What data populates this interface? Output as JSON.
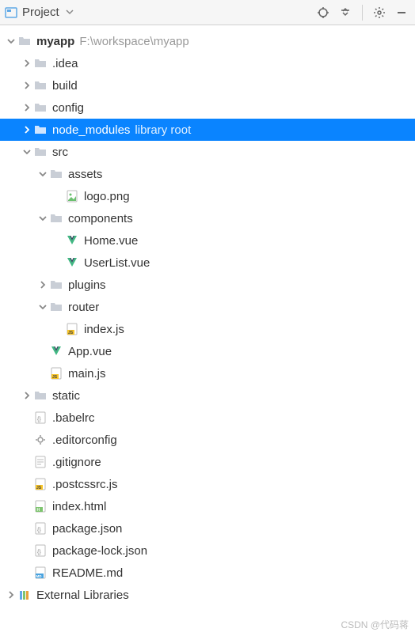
{
  "toolbar": {
    "project_label": "Project"
  },
  "tree": {
    "root": {
      "name": "myapp",
      "path": "F:\\workspace\\myapp"
    },
    "idea": ".idea",
    "build": "build",
    "config": "config",
    "node_modules": {
      "name": "node_modules",
      "hint": "library root"
    },
    "src": "src",
    "assets": "assets",
    "logo": "logo.png",
    "components": "components",
    "home": "Home.vue",
    "userlist": "UserList.vue",
    "plugins": "plugins",
    "router": "router",
    "index_js": "index.js",
    "app_vue": "App.vue",
    "main_js": "main.js",
    "static": "static",
    "babelrc": ".babelrc",
    "editorconfig": ".editorconfig",
    "gitignore": ".gitignore",
    "postcssrc": ".postcssrc.js",
    "index_html": "index.html",
    "package_json": "package.json",
    "package_lock": "package-lock.json",
    "readme": "README.md",
    "external_libs": "External Libraries"
  },
  "watermark": "CSDN @代码蒋"
}
